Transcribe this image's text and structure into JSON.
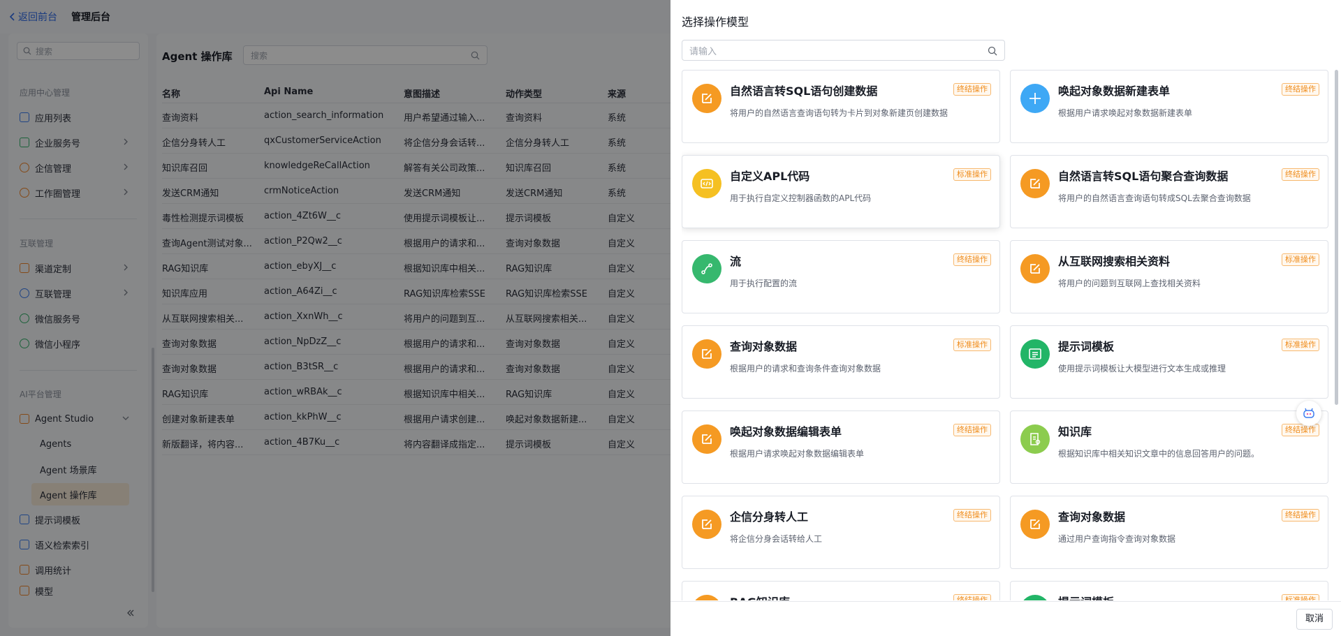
{
  "topbar": {
    "back_label": "返回前台",
    "app_title": "管理后台"
  },
  "sidebar": {
    "search_placeholder": "搜索",
    "groups": [
      "应用中心管理",
      "互联管理",
      "AI平台管理"
    ],
    "items": [
      {
        "label": "应用列表",
        "icon": "grid-icon"
      },
      {
        "label": "企业服务号",
        "icon": "service-account-icon",
        "chev": true
      },
      {
        "label": "企信管理",
        "icon": "chat-circle-icon",
        "chev": true
      },
      {
        "label": "工作圈管理",
        "icon": "compass-icon",
        "chev": true
      },
      {
        "label": "渠道定制",
        "icon": "bar-chart-icon",
        "chev": true
      },
      {
        "label": "互联管理",
        "icon": "link-icon",
        "chev": true
      },
      {
        "label": "微信服务号",
        "icon": "wechat-icon"
      },
      {
        "label": "微信小程序",
        "icon": "mini-program-icon"
      },
      {
        "label": "Agent Studio",
        "icon": "robot-icon",
        "chev": true
      },
      {
        "label": "提示词模板",
        "icon": "prompt-icon"
      },
      {
        "label": "语义检索索引",
        "icon": "index-icon"
      },
      {
        "label": "调用统计",
        "icon": "stats-icon"
      },
      {
        "label": "模型",
        "icon": "model-icon"
      }
    ],
    "subitems": [
      "Agents",
      "Agent 场景库",
      "Agent 操作库"
    ],
    "active_subitem": "Agent 操作库"
  },
  "main": {
    "title": "Agent 操作库",
    "search_placeholder": "搜索",
    "columns": [
      "名称",
      "Api Name",
      "意图描述",
      "动作类型",
      "来源"
    ],
    "rows": [
      [
        "查询资料",
        "action_search_information",
        "用户希望通过输入...",
        "查询资料",
        "系统"
      ],
      [
        "企信分身转人工",
        "qxCustomerServiceAction",
        "将企信分身会话转...",
        "企信分身转人工",
        "系统"
      ],
      [
        "知识库召回",
        "knowledgeReCallAction",
        "解答有关公司政策...",
        "知识库召回",
        "系统"
      ],
      [
        "发送CRM通知",
        "crmNoticeAction",
        "发送CRM通知",
        "发送CRM通知",
        "系统"
      ],
      [
        "毒性检测提示词模板",
        "action_4Zt6W__c",
        "使用提示词模板让...",
        "提示词模板",
        "自定义"
      ],
      [
        "查询Agent测试对象...",
        "action_P2Qw2__c",
        "根据用户的请求和...",
        "查询对象数据",
        "自定义"
      ],
      [
        "RAG知识库",
        "action_ebyXJ__c",
        "根据知识库中相关...",
        "RAG知识库",
        "自定义"
      ],
      [
        "知识库应用",
        "action_A64Zi__c",
        "RAG知识库检索SSE",
        "RAG知识库检索SSE",
        "自定义"
      ],
      [
        "从互联网搜索相关...",
        "action_XxnWh__c",
        "将用户的问题到互...",
        "从互联网搜索相关...",
        "自定义"
      ],
      [
        "查询对象数据",
        "action_NpDzZ__c",
        "根据用户的请求和...",
        "查询对象数据",
        "自定义"
      ],
      [
        "查询对象数据",
        "action_B3tSR__c",
        "根据用户的请求和...",
        "查询对象数据",
        "自定义"
      ],
      [
        "RAG知识库",
        "action_wRBAk__c",
        "根据知识库中相关...",
        "RAG知识库",
        "自定义"
      ],
      [
        "创建对象新建表单",
        "action_kkPhW__c",
        "根据用户请求创建...",
        "唤起对象数据新建...",
        "自定义"
      ],
      [
        "新版翻译，将内容...",
        "action_4B7Ku__c",
        "将内容翻译成指定...",
        "提示词模板",
        "自定义"
      ]
    ]
  },
  "drawer": {
    "title": "选择操作模型",
    "search_placeholder": "请输入",
    "cancel_label": "取消",
    "cards": [
      {
        "name": "自然语言转SQL语句创建数据",
        "desc": "将用户的自然语言查询语句转为卡片到对象新建页创建数据",
        "tag": "终结操作",
        "icon": "edit-icon",
        "color": "#f59a23"
      },
      {
        "name": "唤起对象数据新建表单",
        "desc": "根据用户请求唤起对象数据新建表单",
        "tag": "终结操作",
        "icon": "plus-icon",
        "color": "#3ea8f5"
      },
      {
        "name": "自定义APL代码",
        "desc": "用于执行自定义控制器函数的APL代码",
        "tag": "标准操作",
        "icon": "code-icon",
        "color": "#f5c022"
      },
      {
        "name": "自然语言转SQL语句聚合查询数据",
        "desc": "将用户的自然语言查询语句转成SQL去聚合查询数据",
        "tag": "终结操作",
        "icon": "edit-icon",
        "color": "#f59a23"
      },
      {
        "name": "流",
        "desc": "用于执行配置的流",
        "tag": "终结操作",
        "icon": "flow-icon",
        "color": "#36b86e"
      },
      {
        "name": "从互联网搜索相关资料",
        "desc": "将用户的问题到互联网上查找相关资料",
        "tag": "标准操作",
        "icon": "edit-icon",
        "color": "#f59a23"
      },
      {
        "name": "查询对象数据",
        "desc": "根据用户的请求和查询条件查询对象数据",
        "tag": "标准操作",
        "icon": "edit-icon",
        "color": "#f59a23"
      },
      {
        "name": "提示词模板",
        "desc": "使用提示词模板让大模型进行文本生成或推理",
        "tag": "标准操作",
        "icon": "template-icon",
        "color": "#22b567"
      },
      {
        "name": "唤起对象数据编辑表单",
        "desc": "根据用户请求唤起对象数据编辑表单",
        "tag": "终结操作",
        "icon": "edit-icon",
        "color": "#f59a23"
      },
      {
        "name": "知识库",
        "desc": "根据知识库中相关知识文章中的信息回答用户的问题。",
        "tag": "终结操作",
        "icon": "knowledge-icon",
        "color": "#8ccc4e"
      },
      {
        "name": "企信分身转人工",
        "desc": "将企信分身会话转给人工",
        "tag": "终结操作",
        "icon": "edit-icon",
        "color": "#f59a23"
      },
      {
        "name": "查询对象数据",
        "desc": "通过用户查询指令查询对象数据",
        "tag": "终结操作",
        "icon": "edit-icon",
        "color": "#f59a23"
      },
      {
        "name": "RAG知识库",
        "desc": "",
        "tag": "终结操作",
        "icon": "edit-icon",
        "color": "#f59a23"
      },
      {
        "name": "提示词模板",
        "desc": "",
        "tag": "标准操作",
        "icon": "template-icon",
        "color": "#22b567"
      }
    ]
  }
}
